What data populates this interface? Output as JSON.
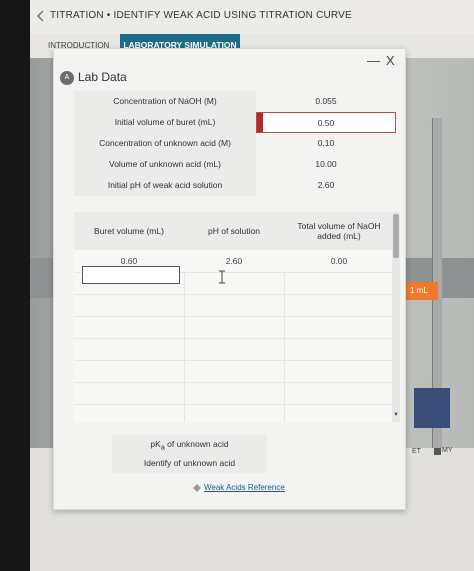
{
  "header": {
    "breadcrumb": "TITRATION • IDENTIFY WEAK ACID USING TITRATION CURVE"
  },
  "tabs": [
    {
      "label": "INTRODUCTION",
      "active": false
    },
    {
      "label": "LABORATORY SIMULATION",
      "active": true
    }
  ],
  "panel": {
    "badge": "A",
    "title": "Lab Data",
    "minimize": "—",
    "close": "X"
  },
  "parameters": [
    {
      "label": "Concentration of NaOH (M)",
      "value": "0.055"
    },
    {
      "label": "Initial volume of buret (mL)",
      "value": "0.50"
    },
    {
      "label": "Concentration of unknown acid (M)",
      "value": "0.10"
    },
    {
      "label": "Volume of unknown acid (mL)",
      "value": "10.00"
    },
    {
      "label": "Initial pH of weak acid solution",
      "value": "2.60"
    }
  ],
  "table": {
    "headers": [
      "Buret volume (mL)",
      "pH of solution",
      "Total volume of NaOH added (mL)"
    ],
    "rows": [
      [
        "0.60",
        "2.60",
        "0.00"
      ]
    ]
  },
  "results": [
    {
      "label": "pKa of unknown acid"
    },
    {
      "label": "Identify of unknown acid"
    }
  ],
  "reference_link": "Weak Acids Reference",
  "lab": {
    "volume_tag": "1 mL",
    "controls": [
      "ET",
      "MY"
    ]
  },
  "colors": {
    "accent": "#1f6b8c",
    "alert": "#b02a2a",
    "tag": "#f07a2c"
  }
}
